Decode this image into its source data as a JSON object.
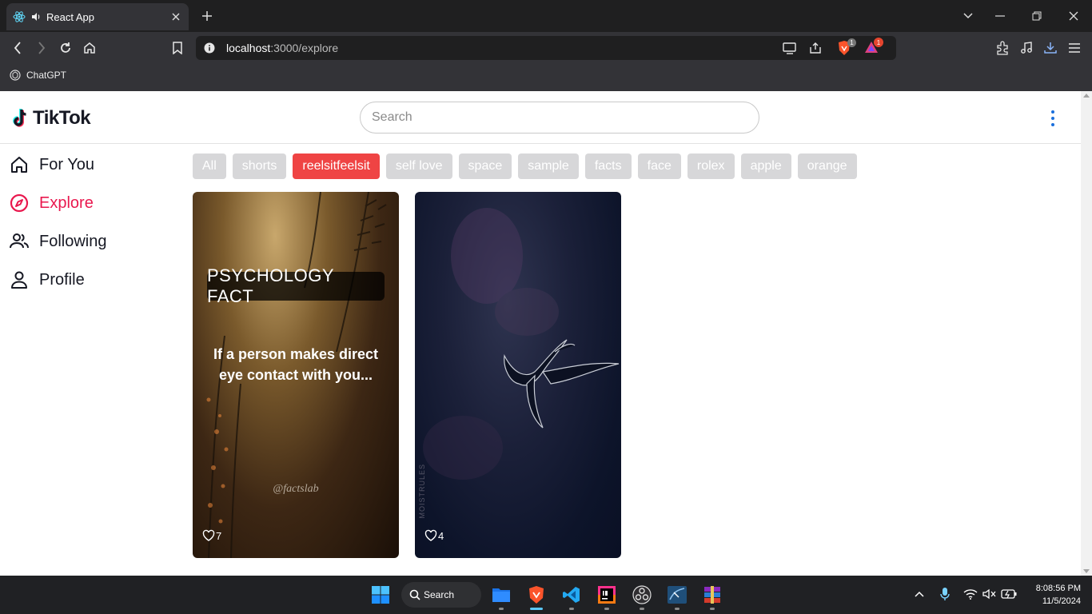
{
  "browser": {
    "tab_title": "React App",
    "address": {
      "host": "localhost",
      "port_path": ":3000/explore"
    },
    "bookmarks": [
      {
        "label": "ChatGPT"
      }
    ],
    "badges": {
      "brave_shields": "1",
      "rewards": "1"
    }
  },
  "header": {
    "logo_text": "TikTok",
    "search_placeholder": "Search"
  },
  "sidebar": {
    "items": [
      {
        "label": "For You",
        "icon": "home-icon",
        "active": false
      },
      {
        "label": "Explore",
        "icon": "compass-icon",
        "active": true
      },
      {
        "label": "Following",
        "icon": "users-icon",
        "active": false
      },
      {
        "label": "Profile",
        "icon": "user-icon",
        "active": false
      }
    ]
  },
  "categories": {
    "items": [
      "All",
      "shorts",
      "reelsitfeelsit",
      "self love",
      "space",
      "sample",
      "facts",
      "face",
      "rolex",
      "apple",
      "orange"
    ],
    "active": "reelsitfeelsit"
  },
  "videos": [
    {
      "overlay_title": "PSYCHOLOGY FACT",
      "caption": "If a person makes direct eye contact with you...",
      "watermark": "@factslab",
      "likes": "7"
    },
    {
      "vertical_watermark": "MOISTRULES",
      "likes": "4"
    }
  ],
  "taskbar": {
    "search_label": "Search",
    "time": "8:08:56 PM",
    "date": "11/5/2024"
  },
  "colors": {
    "accent": "#e9184e",
    "chip_active": "#ef4444",
    "chip_default": "#d7d7d9"
  }
}
